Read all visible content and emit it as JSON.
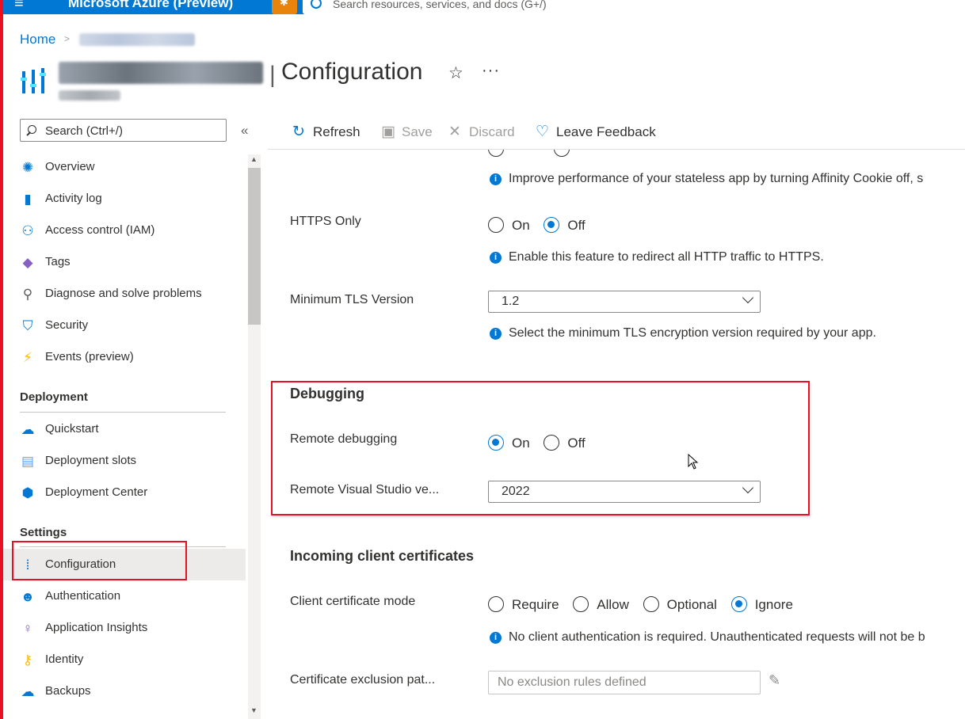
{
  "topbar": {
    "brand": "Microsoft Azure (Preview)",
    "search_placeholder": "Search resources, services, and docs (G+/)"
  },
  "breadcrumb": {
    "home": "Home"
  },
  "header": {
    "title": "Configuration"
  },
  "nav": {
    "search_placeholder": "Search (Ctrl+/)",
    "items": [
      {
        "label": "Overview",
        "icon": "overview-icon"
      },
      {
        "label": "Activity log",
        "icon": "activity-log-icon"
      },
      {
        "label": "Access control (IAM)",
        "icon": "people-icon"
      },
      {
        "label": "Tags",
        "icon": "tag-icon"
      },
      {
        "label": "Diagnose and solve problems",
        "icon": "wrench-icon"
      },
      {
        "label": "Security",
        "icon": "shield-icon"
      },
      {
        "label": "Events (preview)",
        "icon": "lightning-icon"
      }
    ],
    "sections": {
      "deployment": "Deployment",
      "settings": "Settings"
    },
    "deployment_items": [
      {
        "label": "Quickstart",
        "icon": "cloud-quickstart-icon"
      },
      {
        "label": "Deployment slots",
        "icon": "slots-icon"
      },
      {
        "label": "Deployment Center",
        "icon": "cube-icon"
      }
    ],
    "settings_items": [
      {
        "label": "Configuration",
        "icon": "configuration-icon",
        "active": true
      },
      {
        "label": "Authentication",
        "icon": "auth-user-icon"
      },
      {
        "label": "Application Insights",
        "icon": "lightbulb-icon"
      },
      {
        "label": "Identity",
        "icon": "key-icon"
      },
      {
        "label": "Backups",
        "icon": "cloud-backup-icon"
      }
    ]
  },
  "toolbar": {
    "refresh": "Refresh",
    "save": "Save",
    "discard": "Discard",
    "feedback": "Leave Feedback"
  },
  "settings": {
    "affinity_info": "Improve performance of your stateless app by turning Affinity Cookie off, s",
    "https_only": {
      "label": "HTTPS Only",
      "on": "On",
      "off": "Off",
      "selected": "Off",
      "info": "Enable this feature to redirect all HTTP traffic to HTTPS."
    },
    "min_tls": {
      "label": "Minimum TLS Version",
      "value": "1.2",
      "info": "Select the minimum TLS encryption version required by your app."
    },
    "debugging": {
      "title": "Debugging",
      "remote_label": "Remote debugging",
      "on": "On",
      "off": "Off",
      "selected": "On",
      "vs_label": "Remote Visual Studio ve...",
      "vs_value": "2022"
    },
    "client_certs": {
      "title": "Incoming client certificates",
      "mode_label": "Client certificate mode",
      "options": [
        "Require",
        "Allow",
        "Optional",
        "Ignore"
      ],
      "selected": "Ignore",
      "info": "No client authentication is required. Unauthenticated requests will not be b",
      "exclusion_label": "Certificate exclusion pat...",
      "exclusion_placeholder": "No exclusion rules defined"
    }
  },
  "colors": {
    "azure_blue": "#0078d4",
    "highlight_red": "#e81123"
  }
}
